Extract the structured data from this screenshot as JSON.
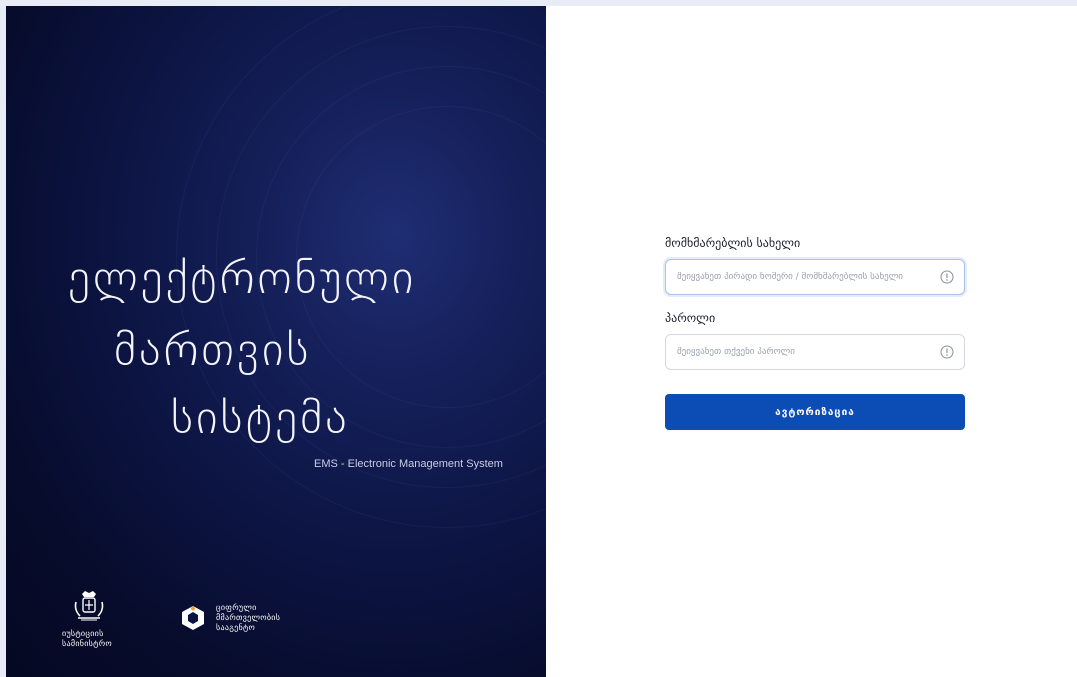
{
  "hero": {
    "title_line1": "ელექტრონული",
    "title_line2": "მართვის",
    "title_line3": "სისტემა",
    "subtitle": "EMS - Electronic Management System"
  },
  "logos": {
    "ministry_line1": "იუსტიციის",
    "ministry_line2": "სამინისტრო",
    "agency_line1": "ციფრული",
    "agency_line2": "მმართველობის",
    "agency_line3": "სააგენტო"
  },
  "form": {
    "username_label": "მომხმარებლის სახელი",
    "username_placeholder": "შეიყვანეთ პირადი ნომერი / მომხმარებლის სახელი",
    "username_value": "",
    "password_label": "პაროლი",
    "password_placeholder": "შეიყვანეთ თქვენი პაროლი",
    "password_value": "",
    "submit_label": "ავტორიზაცია"
  },
  "colors": {
    "panel_dark": "#070c2c",
    "panel_accent": "#1f2d73",
    "button": "#0b4db5",
    "focus_border": "#a9c3ec"
  },
  "icons": {
    "username_info": "info-circle-icon",
    "password_info": "info-circle-icon",
    "ministry": "coat-of-arms-icon",
    "agency": "agency-logo-icon"
  }
}
